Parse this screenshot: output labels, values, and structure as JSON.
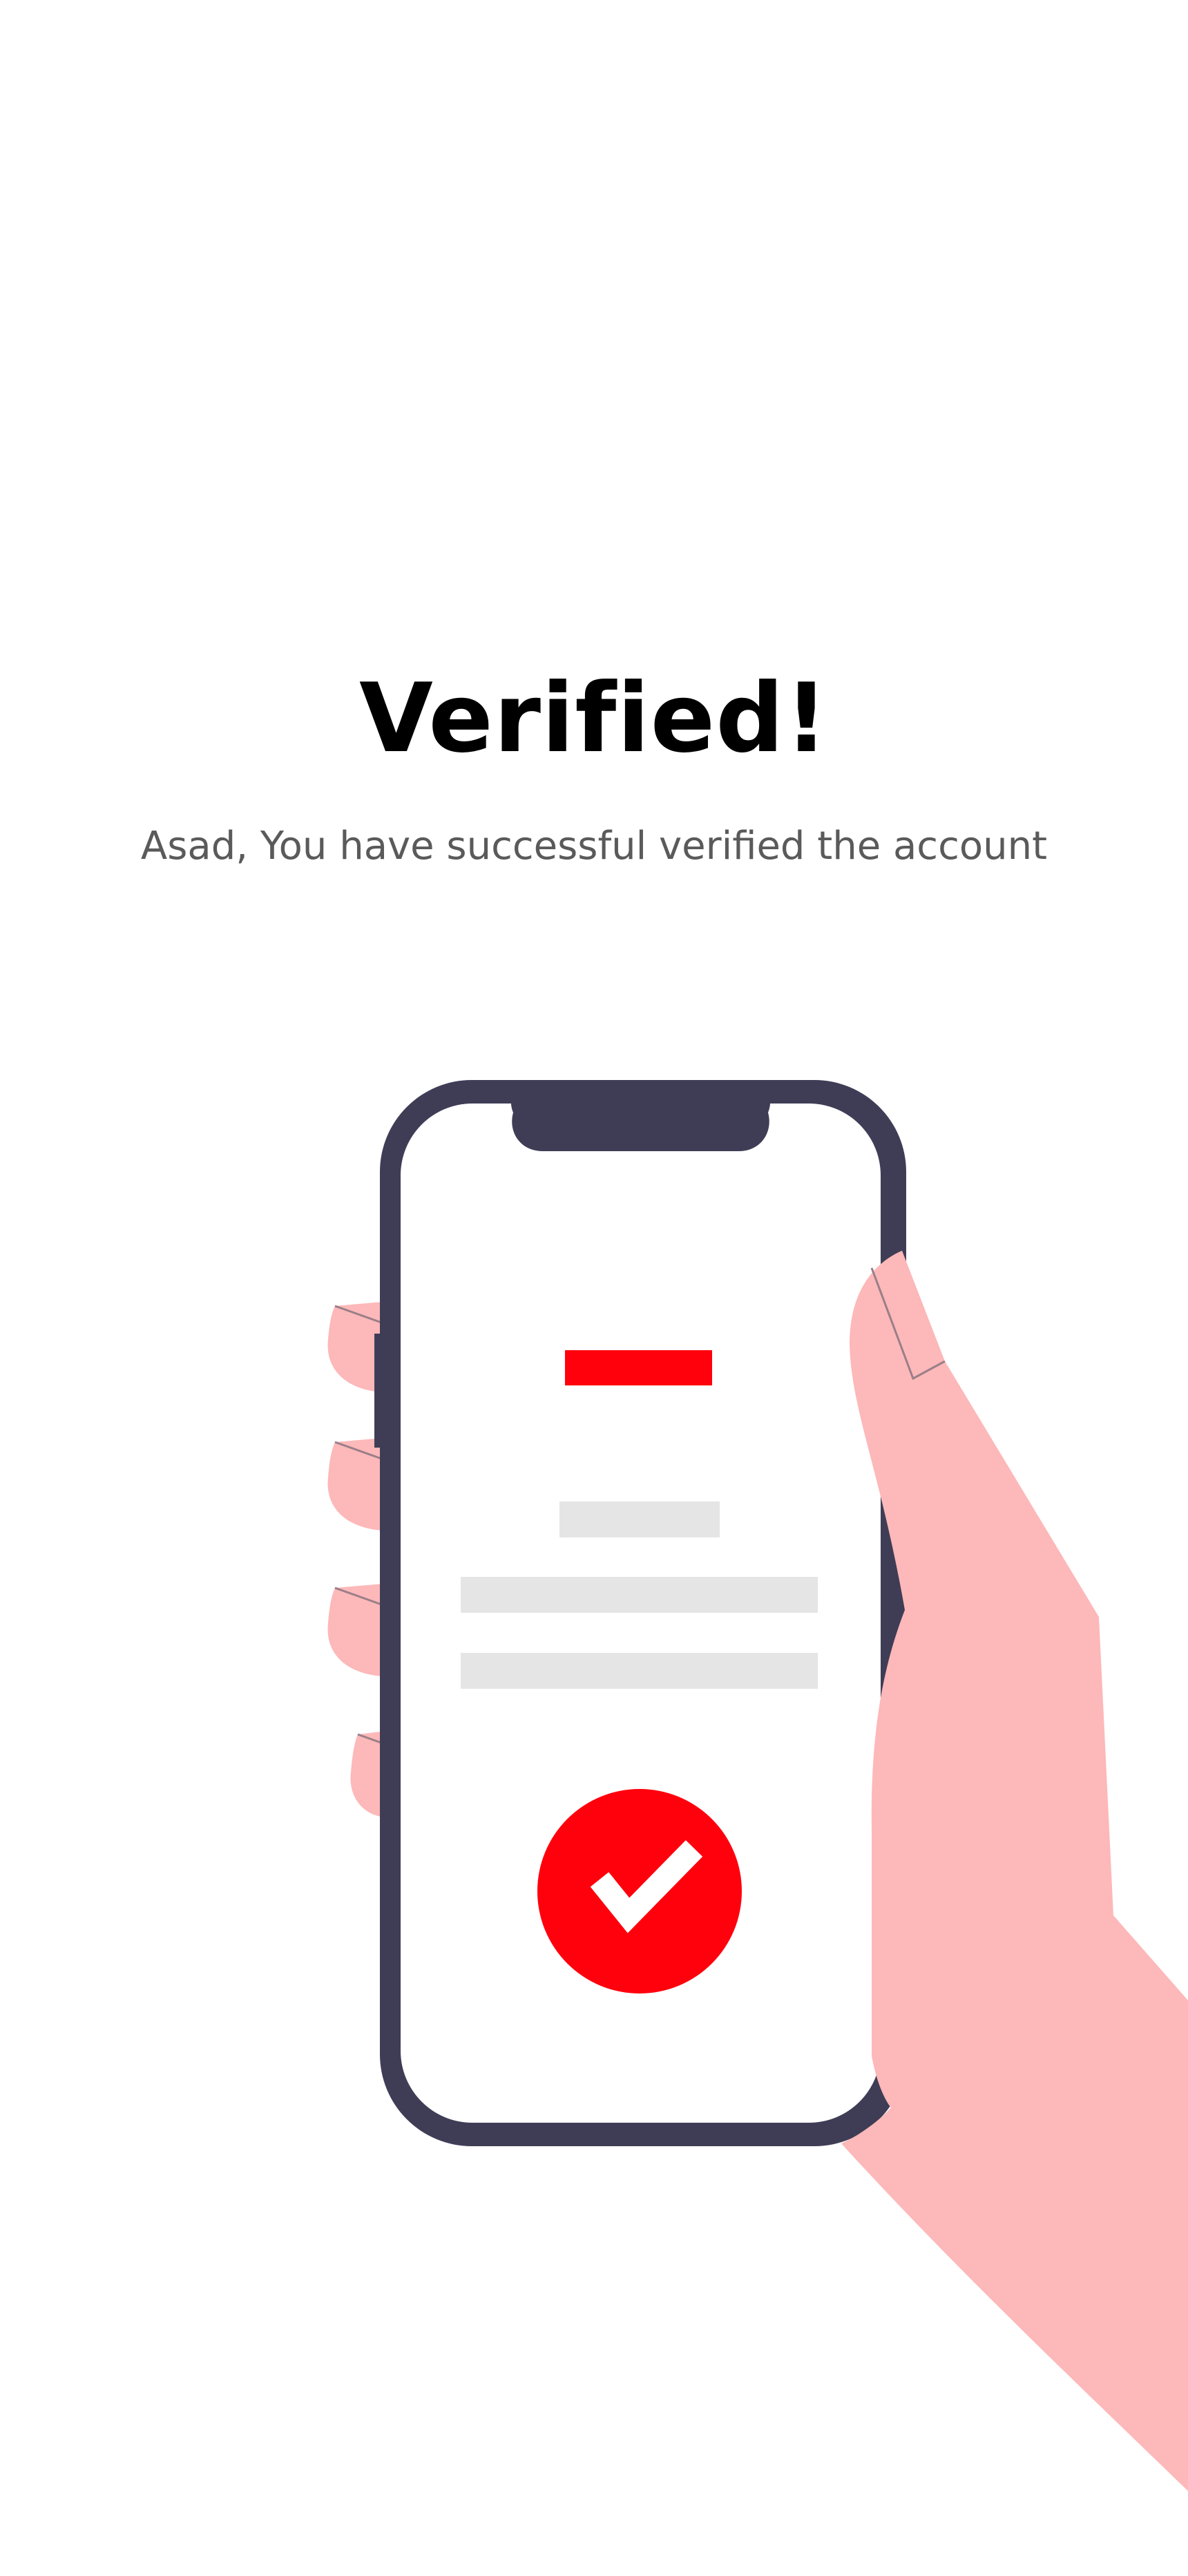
{
  "screen": {
    "title": "Verified!",
    "subtitle": "Asad, You have successful verified the account"
  },
  "illustration": {
    "icons": {
      "check": "check-circle-icon"
    },
    "colors": {
      "accent": "#FF000D",
      "phone_frame": "#3F3D56",
      "skin": "#FDB8B9",
      "placeholder": "#E5E5E5",
      "screen": "#FFFFFF"
    }
  }
}
